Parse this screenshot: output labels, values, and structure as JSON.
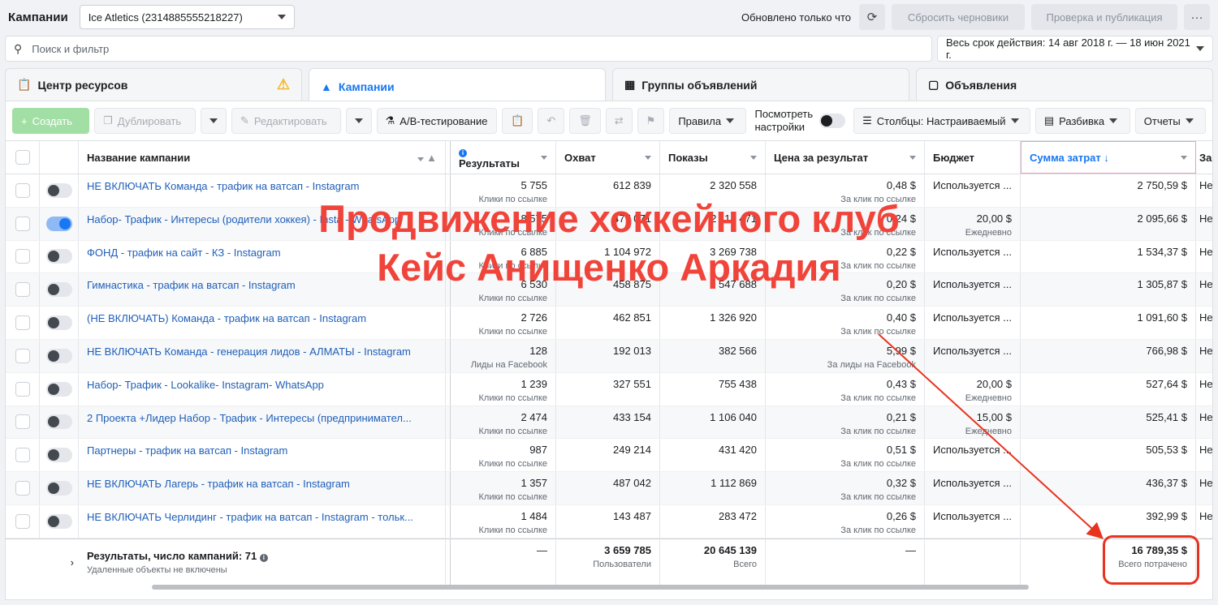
{
  "topbar": {
    "title": "Кампании",
    "account": "Ice Atletics (2314885555218227)",
    "updated": "Обновлено только что",
    "reset_drafts": "Сбросить черновики",
    "review_publish": "Проверка и публикация",
    "more": "···"
  },
  "search": {
    "placeholder": "Поиск и фильтр"
  },
  "date_range": "Весь срок действия: 14 авг 2018 г. — 18 июн 2021 г.",
  "tabs": [
    {
      "label": "Центр ресурсов",
      "icon": "clipboard-icon"
    },
    {
      "label": "Кампании",
      "icon": "folder-icon"
    },
    {
      "label": "Группы объявлений",
      "icon": "grid-icon"
    },
    {
      "label": "Объявления",
      "icon": "ad-icon"
    }
  ],
  "toolbar": {
    "create": "Создать",
    "duplicate": "Дублировать",
    "edit": "Редактировать",
    "ab_test": "A/B-тестирование",
    "rules": "Правила",
    "view_settings_1": "Посмотреть",
    "view_settings_2": "настройки",
    "columns": "Столбцы: Настраиваемый",
    "breakdown": "Разбивка",
    "reports": "Отчеты"
  },
  "columns": {
    "name": "Название кампании",
    "results": "Результаты",
    "reach": "Охват",
    "impressions": "Показы",
    "cpr": "Цена за результат",
    "budget": "Бюджет",
    "spend": "Сумма затрат ↓",
    "more": "За"
  },
  "rows": [
    {
      "name": "НЕ ВКЛЮЧАТЬ Команда - трафик на ватсап - Instagram",
      "on": false,
      "results": "5 755",
      "results_sub": "Клики по ссылке",
      "reach": "612 839",
      "impressions": "2 320 558",
      "cpr": "0,48 $",
      "cpr_sub": "За клик по ссылке",
      "budget": "Используется ...",
      "budget_sub": "",
      "spend": "2 750,59 $",
      "more": "Не"
    },
    {
      "name": "Набор- Трафик - Интересы (родители хоккея) - Insta - WhatsApp",
      "on": true,
      "results": "8 575",
      "results_sub": "Клики по ссылке",
      "reach": "477 071",
      "impressions": "2 114 471",
      "cpr": "0,24 $",
      "cpr_sub": "За клик по ссылке",
      "budget": "20,00 $",
      "budget_sub": "Ежедневно",
      "spend": "2 095,66 $",
      "more": "Не"
    },
    {
      "name": "ФОНД - трафик на сайт - КЗ - Instagram",
      "on": false,
      "results": "6 885",
      "results_sub": "Клики по ссылке",
      "reach": "1 104 972",
      "impressions": "3 269 738",
      "cpr": "0,22 $",
      "cpr_sub": "За клик по ссылке",
      "budget": "Используется ...",
      "budget_sub": "",
      "spend": "1 534,37 $",
      "more": "Не"
    },
    {
      "name": "Гимнастика - трафик на ватсап - Instagram",
      "on": false,
      "results": "6 530",
      "results_sub": "Клики по ссылке",
      "reach": "458 875",
      "impressions": "1 547 688",
      "cpr": "0,20 $",
      "cpr_sub": "За клик по ссылке",
      "budget": "Используется ...",
      "budget_sub": "",
      "spend": "1 305,87 $",
      "more": "Не"
    },
    {
      "name": "(НЕ ВКЛЮЧАТЬ) Команда - трафик на ватсап - Instagram",
      "on": false,
      "results": "2 726",
      "results_sub": "Клики по ссылке",
      "reach": "462 851",
      "impressions": "1 326 920",
      "cpr": "0,40 $",
      "cpr_sub": "За клик по ссылке",
      "budget": "Используется ...",
      "budget_sub": "",
      "spend": "1 091,60 $",
      "more": "Не"
    },
    {
      "name": "НЕ ВКЛЮЧАТЬ Команда - генерация лидов - АЛМАТЫ - Instagram",
      "on": false,
      "results": "128",
      "results_sub": "Лиды на Facebook",
      "reach": "192 013",
      "impressions": "382 566",
      "cpr": "5,99 $",
      "cpr_sub": "За лиды на Facebook",
      "budget": "Используется ...",
      "budget_sub": "",
      "spend": "766,98 $",
      "more": "Не"
    },
    {
      "name": "Набор- Трафик - Lookalike- Instagram- WhatsApp",
      "on": false,
      "results": "1 239",
      "results_sub": "Клики по ссылке",
      "reach": "327 551",
      "impressions": "755 438",
      "cpr": "0,43 $",
      "cpr_sub": "За клик по ссылке",
      "budget": "20,00 $",
      "budget_sub": "Ежедневно",
      "spend": "527,64 $",
      "more": "Не"
    },
    {
      "name": "2 Проекта +Лидер Набор - Трафик - Интересы (предпринимател...",
      "on": false,
      "results": "2 474",
      "results_sub": "Клики по ссылке",
      "reach": "433 154",
      "impressions": "1 106 040",
      "cpr": "0,21 $",
      "cpr_sub": "За клик по ссылке",
      "budget": "15,00 $",
      "budget_sub": "Ежедневно",
      "spend": "525,41 $",
      "more": "Не"
    },
    {
      "name": "Партнеры - трафик на ватсап - Instagram",
      "on": false,
      "results": "987",
      "results_sub": "Клики по ссылке",
      "reach": "249 214",
      "impressions": "431 420",
      "cpr": "0,51 $",
      "cpr_sub": "За клик по ссылке",
      "budget": "Используется ...",
      "budget_sub": "",
      "spend": "505,53 $",
      "more": "Не"
    },
    {
      "name": "НЕ ВКЛЮЧАТЬ Лагерь - трафик на ватсап - Instagram",
      "on": false,
      "results": "1 357",
      "results_sub": "Клики по ссылке",
      "reach": "487 042",
      "impressions": "1 112 869",
      "cpr": "0,32 $",
      "cpr_sub": "За клик по ссылке",
      "budget": "Используется ...",
      "budget_sub": "",
      "spend": "436,37 $",
      "more": "Не"
    },
    {
      "name": "НЕ ВКЛЮЧАТЬ Черлидинг - трафик на ватсап - Instagram - тольк...",
      "on": false,
      "results": "1 484",
      "results_sub": "Клики по ссылке",
      "reach": "143 487",
      "impressions": "283 472",
      "cpr": "0,26 $",
      "cpr_sub": "За клик по ссылке",
      "budget": "Используется ...",
      "budget_sub": "",
      "spend": "392,99 $",
      "more": "Не"
    }
  ],
  "footer": {
    "label": "Результаты, число кампаний: 71",
    "note": "Удаленные объекты не включены",
    "results": "—",
    "reach": "3 659 785",
    "reach_sub": "Пользователи",
    "impressions": "20 645 139",
    "impressions_sub": "Всего",
    "cpr": "—",
    "spend": "16 789,35 $",
    "spend_sub": "Всего потрачено"
  },
  "overlay": {
    "line1": "Продвижение хоккейного клуб",
    "line2": "Кейс Анищенко Аркадия"
  },
  "colors": {
    "accent": "#1877f2",
    "annotation": "#e8331e"
  }
}
